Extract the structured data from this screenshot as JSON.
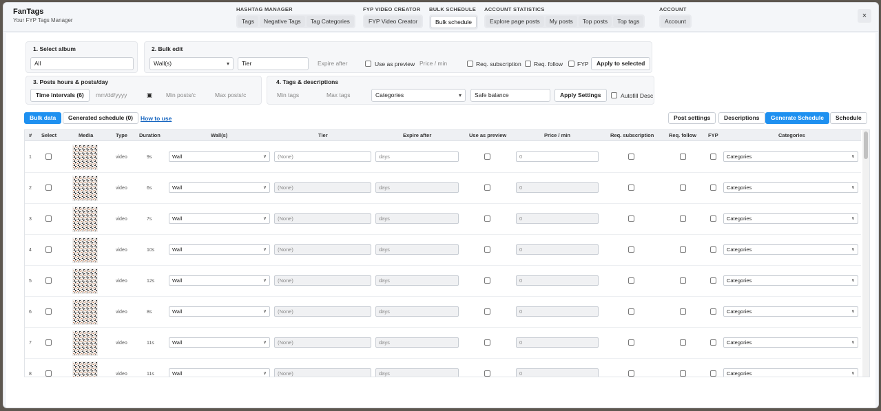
{
  "brand": {
    "title": "FanTags",
    "subtitle": "Your FYP Tags Manager"
  },
  "nav": [
    {
      "title": "HASHTAG MANAGER",
      "buttons": [
        "Tags",
        "Negative Tags",
        "Tag Categories"
      ]
    },
    {
      "title": "FYP VIDEO CREATOR",
      "buttons": [
        "FYP Video Creator"
      ]
    },
    {
      "title": "BULK SCHEDULE",
      "buttons": [
        "Bulk schedule"
      ]
    },
    {
      "title": "ACCOUNT STATISTICS",
      "buttons": [
        "Explore page posts",
        "My posts",
        "Top posts",
        "Top tags"
      ]
    },
    {
      "title": "ACCOUNT",
      "buttons": [
        "Account"
      ]
    }
  ],
  "close_glyph": "×",
  "select_album": {
    "title": "1. Select album",
    "value": "All"
  },
  "bulk_edit": {
    "title": "2. Bulk edit",
    "wall_value": "Wall(s)",
    "tier_value": "Tier",
    "expire_placeholder": "Expire after",
    "use_as_preview": "Use as preview",
    "price_placeholder": "Price / min",
    "req_subscription": "Req. subscription",
    "req_follow": "Req. follow",
    "fyp": "FYP",
    "apply_button": "Apply to selected"
  },
  "posts_hours": {
    "title": "3. Posts hours & posts/day",
    "time_intervals_button": "Time intervals (6)",
    "date_placeholder": "mm/dd/yyyy",
    "min_posts": "Min posts/c",
    "max_posts": "Max posts/c"
  },
  "tags_desc": {
    "title": "4. Tags & descriptions",
    "min_tags": "Min tags",
    "max_tags": "Max tags",
    "categories_value": "Categories",
    "safe_balance_value": "Safe balance",
    "apply_settings_button": "Apply Settings",
    "autofill_desc": "Autofill Desc"
  },
  "toolbar": {
    "bulk_data": "Bulk data",
    "generated_schedule": "Generated schedule (0)",
    "how_to_use": "How to use",
    "post_settings": "Post settings",
    "descriptions": "Descriptions",
    "generate_schedule": "Generate Schedule",
    "schedule": "Schedule"
  },
  "table": {
    "headers": [
      "#",
      "Select",
      "Media",
      "Type",
      "Duration",
      "Wall(s)",
      "Tier",
      "Expire after",
      "Use as preview",
      "Price / min",
      "Req. subscription",
      "Req. follow",
      "FYP",
      "Categories"
    ],
    "rows": [
      {
        "num": "1",
        "type": "video",
        "duration": "9s",
        "wall": "Wall",
        "tier": "(None)",
        "expire": "days",
        "price": "0",
        "categories": "Categories"
      },
      {
        "num": "2",
        "type": "video",
        "duration": "6s",
        "wall": "Wall",
        "tier": "(None)",
        "expire": "days",
        "price": "0",
        "categories": "Categories"
      },
      {
        "num": "3",
        "type": "video",
        "duration": "7s",
        "wall": "Wall",
        "tier": "(None)",
        "expire": "days",
        "price": "0",
        "categories": "Categories"
      },
      {
        "num": "4",
        "type": "video",
        "duration": "10s",
        "wall": "Wall",
        "tier": "(None)",
        "expire": "days",
        "price": "0",
        "categories": "Categories"
      },
      {
        "num": "5",
        "type": "video",
        "duration": "12s",
        "wall": "Wall",
        "tier": "(None)",
        "expire": "days",
        "price": "0",
        "categories": "Categories"
      },
      {
        "num": "6",
        "type": "video",
        "duration": "8s",
        "wall": "Wall",
        "tier": "(None)",
        "expire": "days",
        "price": "0",
        "categories": "Categories"
      },
      {
        "num": "7",
        "type": "video",
        "duration": "11s",
        "wall": "Wall",
        "tier": "(None)",
        "expire": "days",
        "price": "0",
        "categories": "Categories"
      },
      {
        "num": "8",
        "type": "video",
        "duration": "11s",
        "wall": "Wall",
        "tier": "(None)",
        "expire": "days",
        "price": "0",
        "categories": "Categories"
      }
    ]
  },
  "colors": {
    "accent": "#1e90f0",
    "link": "#1565c0"
  }
}
